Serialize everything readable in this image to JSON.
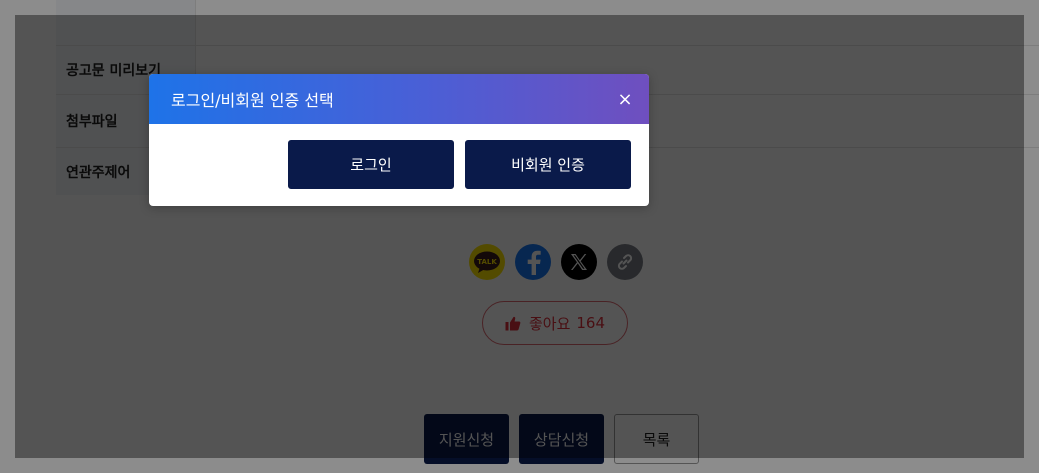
{
  "table": {
    "rows": [
      {
        "label": ""
      },
      {
        "label": "공고문 미리보기"
      },
      {
        "label": "첨부파일"
      },
      {
        "label": "연관주제어"
      }
    ]
  },
  "share": {
    "kakao_label": "TALK",
    "icons": [
      "kakaotalk-icon",
      "facebook-icon",
      "x-icon",
      "link-icon"
    ]
  },
  "like": {
    "label": "좋아요",
    "count": "164"
  },
  "actions": {
    "apply": "지원신청",
    "consult": "상담신청",
    "list": "목록"
  },
  "modal": {
    "title": "로그인/비회원 인증 선택",
    "close_symbol": "×",
    "login": "로그인",
    "guest": "비회원 인증"
  },
  "colors": {
    "primary_navy": "#0a1a4a",
    "like_red": "#e0313d",
    "header_gradient_start": "#1e73e8",
    "header_gradient_end": "#6f4fbf"
  }
}
